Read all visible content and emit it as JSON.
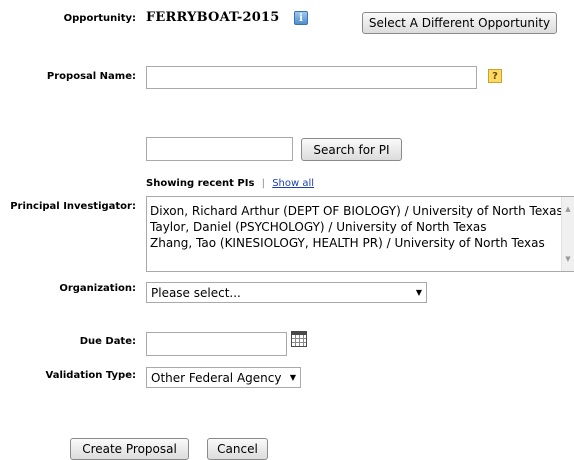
{
  "opportunity": {
    "label": "Opportunity:",
    "value": "FERRYBOAT-2015",
    "info_icon": "i",
    "select_button": "Select A Different Opportunity"
  },
  "proposal_name": {
    "label": "Proposal Name:",
    "value": "",
    "help_icon": "?"
  },
  "pi_search": {
    "value": "",
    "button": "Search for PI",
    "showing_text": "Showing recent PIs",
    "separator": "|",
    "show_all": "Show all"
  },
  "principal_investigator": {
    "label": "Principal Investigator:",
    "items": [
      "Dixon, Richard Arthur (DEPT OF BIOLOGY) / University of North Texas",
      "Taylor, Daniel (PSYCHOLOGY) / University of North Texas",
      "Zhang, Tao (KINESIOLOGY, HEALTH PR) / University of North Texas"
    ]
  },
  "organization": {
    "label": "Organization:",
    "selected": "Please select..."
  },
  "due_date": {
    "label": "Due Date:",
    "value": ""
  },
  "validation_type": {
    "label": "Validation Type:",
    "selected": "Other Federal Agency"
  },
  "actions": {
    "create": "Create Proposal",
    "cancel": "Cancel"
  },
  "icons": {
    "info": "info-icon",
    "help": "help-icon",
    "calendar": "calendar-icon",
    "dropdown": "chevron-down-icon"
  },
  "colors": {
    "link": "#1a3fb5",
    "info_icon": "#4f8fce",
    "help_icon": "#ffd966"
  }
}
